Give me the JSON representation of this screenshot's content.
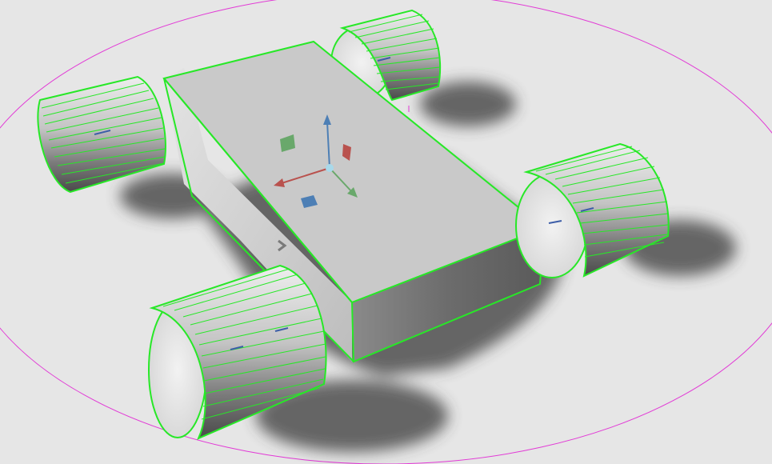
{
  "viewport": {
    "background": "#e6e6e6",
    "selection_color": "#27e827",
    "boundary_color": "#e23ad6",
    "shadow_color": "#3a3a3a",
    "body_top_color": "#c9c9c9",
    "wheel_axis_color": "#3d5ea8"
  },
  "gizmo": {
    "type": "translate",
    "axes": [
      {
        "name": "x-axis",
        "color": "#b9524e"
      },
      {
        "name": "y-axis",
        "color": "#69a86b"
      },
      {
        "name": "z-axis",
        "color": "#4d7fb5"
      }
    ],
    "planes": [
      {
        "name": "xy-plane-handle",
        "color": "#4d7fb5"
      },
      {
        "name": "xz-plane-handle",
        "color": "#69a86b"
      },
      {
        "name": "yz-plane-handle",
        "color": "#b9524e"
      }
    ],
    "center_color": "#a8d9ea"
  },
  "objects": {
    "body": {
      "name": "chassis-box",
      "selected": true
    },
    "wheels": [
      {
        "name": "wheel-front-left",
        "selected": true
      },
      {
        "name": "wheel-back-left",
        "selected": true
      },
      {
        "name": "wheel-front-right",
        "selected": true
      },
      {
        "name": "wheel-back-right",
        "selected": true
      }
    ]
  },
  "icons": {
    "expand": "chevron-right-icon"
  }
}
